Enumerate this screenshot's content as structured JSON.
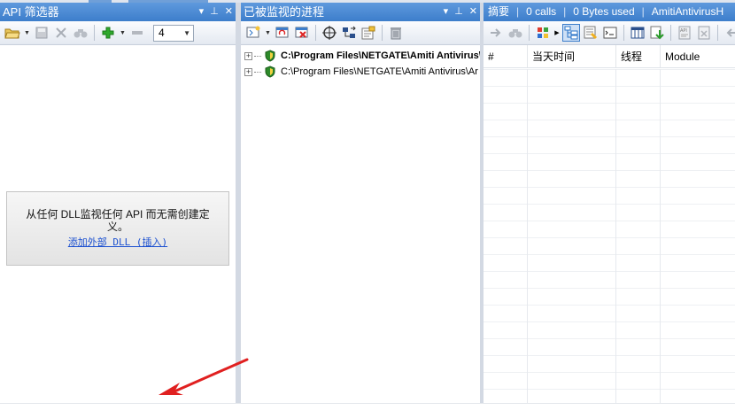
{
  "api_filter": {
    "title": "API 筛选器",
    "count_value": "4",
    "empty_message": "从任何 DLL监视任何 API 而无需创建定义。",
    "add_dll_link": "添加外部 DLL (插入)"
  },
  "processes": {
    "title": "已被监视的进程",
    "items": [
      {
        "path": "C:\\Program Files\\NETGATE\\Amiti Antivirus\\",
        "bold": true
      },
      {
        "path": "C:\\Program Files\\NETGATE\\Amiti Antivirus\\Ar",
        "bold": false
      }
    ]
  },
  "summary": {
    "title": "摘要",
    "calls": "0 calls",
    "bytes": "0 Bytes used",
    "process_name": "AmitiAntivirusH",
    "columns": [
      "#",
      "当天时间",
      "线程",
      "Module"
    ]
  },
  "colors": {
    "titlebar": "#4a8ad4",
    "link": "#1a4fd0",
    "arrow": "#e02020"
  }
}
